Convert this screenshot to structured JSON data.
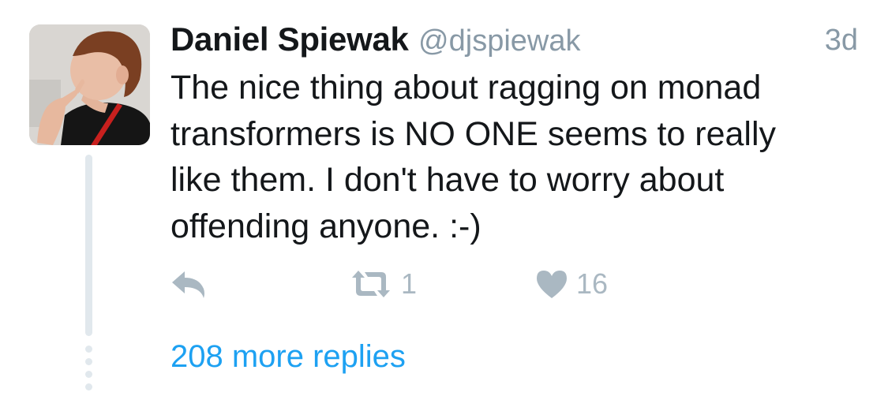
{
  "tweet": {
    "author_name": "Daniel Spiewak",
    "author_handle": "@djspiewak",
    "timestamp": "3d",
    "text_lines": [
      "The nice thing about ragging on monad",
      "transformers is NO ONE seems to really",
      "like them. I don't have to worry about",
      "offending anyone. :-)"
    ],
    "retweet_count": "1",
    "like_count": "16",
    "more_replies_label": "208 more replies"
  },
  "icons": {
    "reply": "reply-icon",
    "retweet": "retweet-icon",
    "like": "heart-icon"
  },
  "colors": {
    "text": "#14171a",
    "muted": "#8899a6",
    "action": "#aab8c2",
    "link": "#1da1f2",
    "thread_line": "#e1e8ed"
  }
}
